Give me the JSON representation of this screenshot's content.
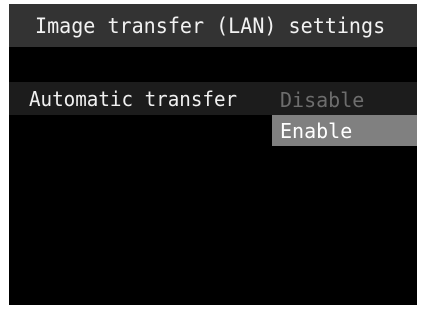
{
  "screen": {
    "title": "Image transfer (LAN) settings"
  },
  "setting": {
    "label": "Automatic transfer",
    "options": [
      {
        "label": "Disable",
        "selected": false
      },
      {
        "label": "Enable",
        "selected": true
      }
    ]
  },
  "colors": {
    "background": "#000000",
    "title_bar": "#333333",
    "selected_option": "#808080",
    "dimmed_text": "#6d6d6d"
  }
}
